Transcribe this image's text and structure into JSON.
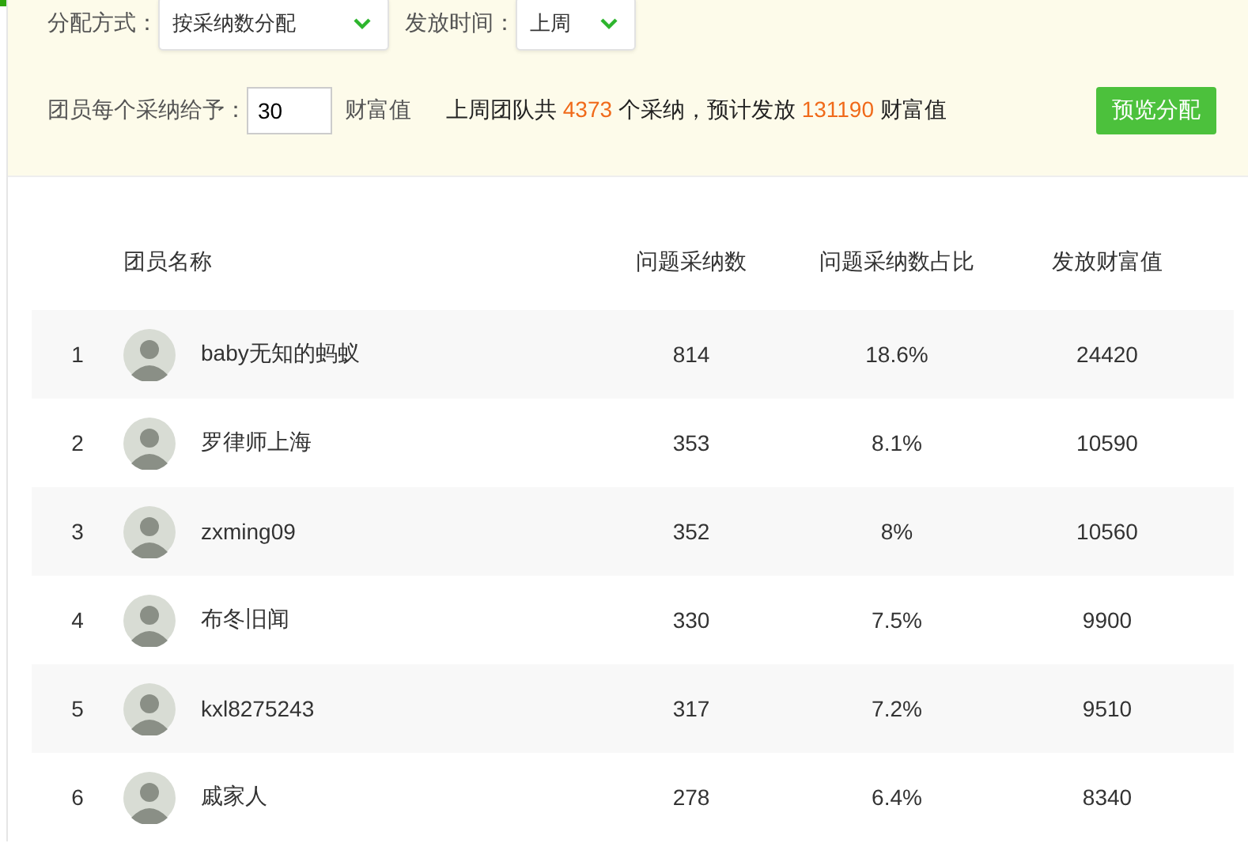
{
  "filters": {
    "method": {
      "label": "分配方式：",
      "value": "按采纳数分配"
    },
    "period": {
      "label": "发放时间：",
      "value": "上周"
    }
  },
  "reward": {
    "label": "团员每个采纳给予：",
    "value": "30",
    "unit": "财富值"
  },
  "summary": [
    {
      "text": "上周团队共 ",
      "highlight": false
    },
    {
      "text": "4373",
      "highlight": true
    },
    {
      "text": " 个采纳，预计发放 ",
      "highlight": false
    },
    {
      "text": "131190",
      "highlight": true
    },
    {
      "text": " 财富值",
      "highlight": false
    }
  ],
  "preview_button": "预览分配",
  "table": {
    "columns": [
      "团员名称",
      "问题采纳数",
      "问题采纳数占比",
      "发放财富值"
    ],
    "rows": [
      {
        "rank": "1",
        "name": "baby无知的蚂蚁",
        "adopted": "814",
        "share": "18.6%",
        "wealth": "24420"
      },
      {
        "rank": "2",
        "name": "罗律师上海",
        "adopted": "353",
        "share": "8.1%",
        "wealth": "10590"
      },
      {
        "rank": "3",
        "name": "zxming09",
        "adopted": "352",
        "share": "8%",
        "wealth": "10560"
      },
      {
        "rank": "4",
        "name": "布冬旧闻",
        "adopted": "330",
        "share": "7.5%",
        "wealth": "9900"
      },
      {
        "rank": "5",
        "name": "kxl8275243",
        "adopted": "317",
        "share": "7.2%",
        "wealth": "9510"
      },
      {
        "rank": "6",
        "name": "戚家人",
        "adopted": "278",
        "share": "6.4%",
        "wealth": "8340"
      }
    ]
  }
}
